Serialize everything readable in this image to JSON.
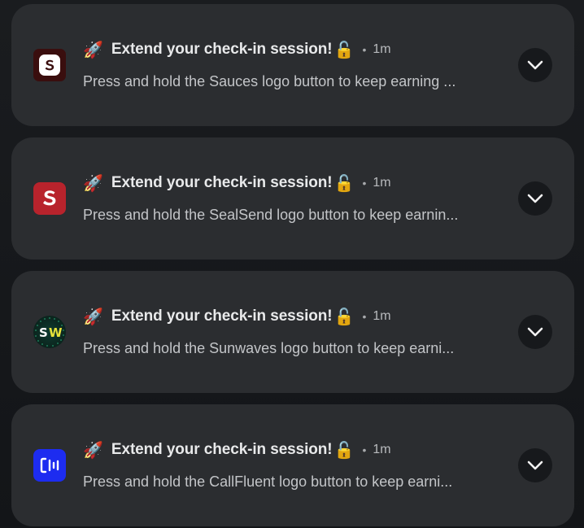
{
  "notifications": [
    {
      "app": "Sauces",
      "icon": "sauces-app-icon",
      "icon_bg": "#3a0e0e",
      "title": "Extend your check-in session!",
      "time": "1m",
      "separator": "•",
      "body": "Press and hold the Sauces logo button to keep earning ..."
    },
    {
      "app": "SealSend",
      "icon": "sealsend-app-icon",
      "icon_bg": "#b8232c",
      "title": "Extend your check-in session!",
      "time": "1m",
      "separator": "•",
      "body": "Press and hold the SealSend logo button to keep earnin..."
    },
    {
      "app": "Sunwaves",
      "icon": "sunwaves-app-icon",
      "icon_bg": "#0e2a22",
      "title": "Extend your check-in session!",
      "time": "1m",
      "separator": "•",
      "body": "Press and hold the Sunwaves logo button to keep earni..."
    },
    {
      "app": "CallFluent",
      "icon": "callfluent-app-icon",
      "icon_bg": "#1d2cf0",
      "title": "Extend your check-in session!",
      "time": "1m",
      "separator": "•",
      "body": "Press and hold the CallFluent logo button to keep earni..."
    }
  ],
  "emoji": {
    "rocket": "🚀",
    "lock": "🔓"
  }
}
